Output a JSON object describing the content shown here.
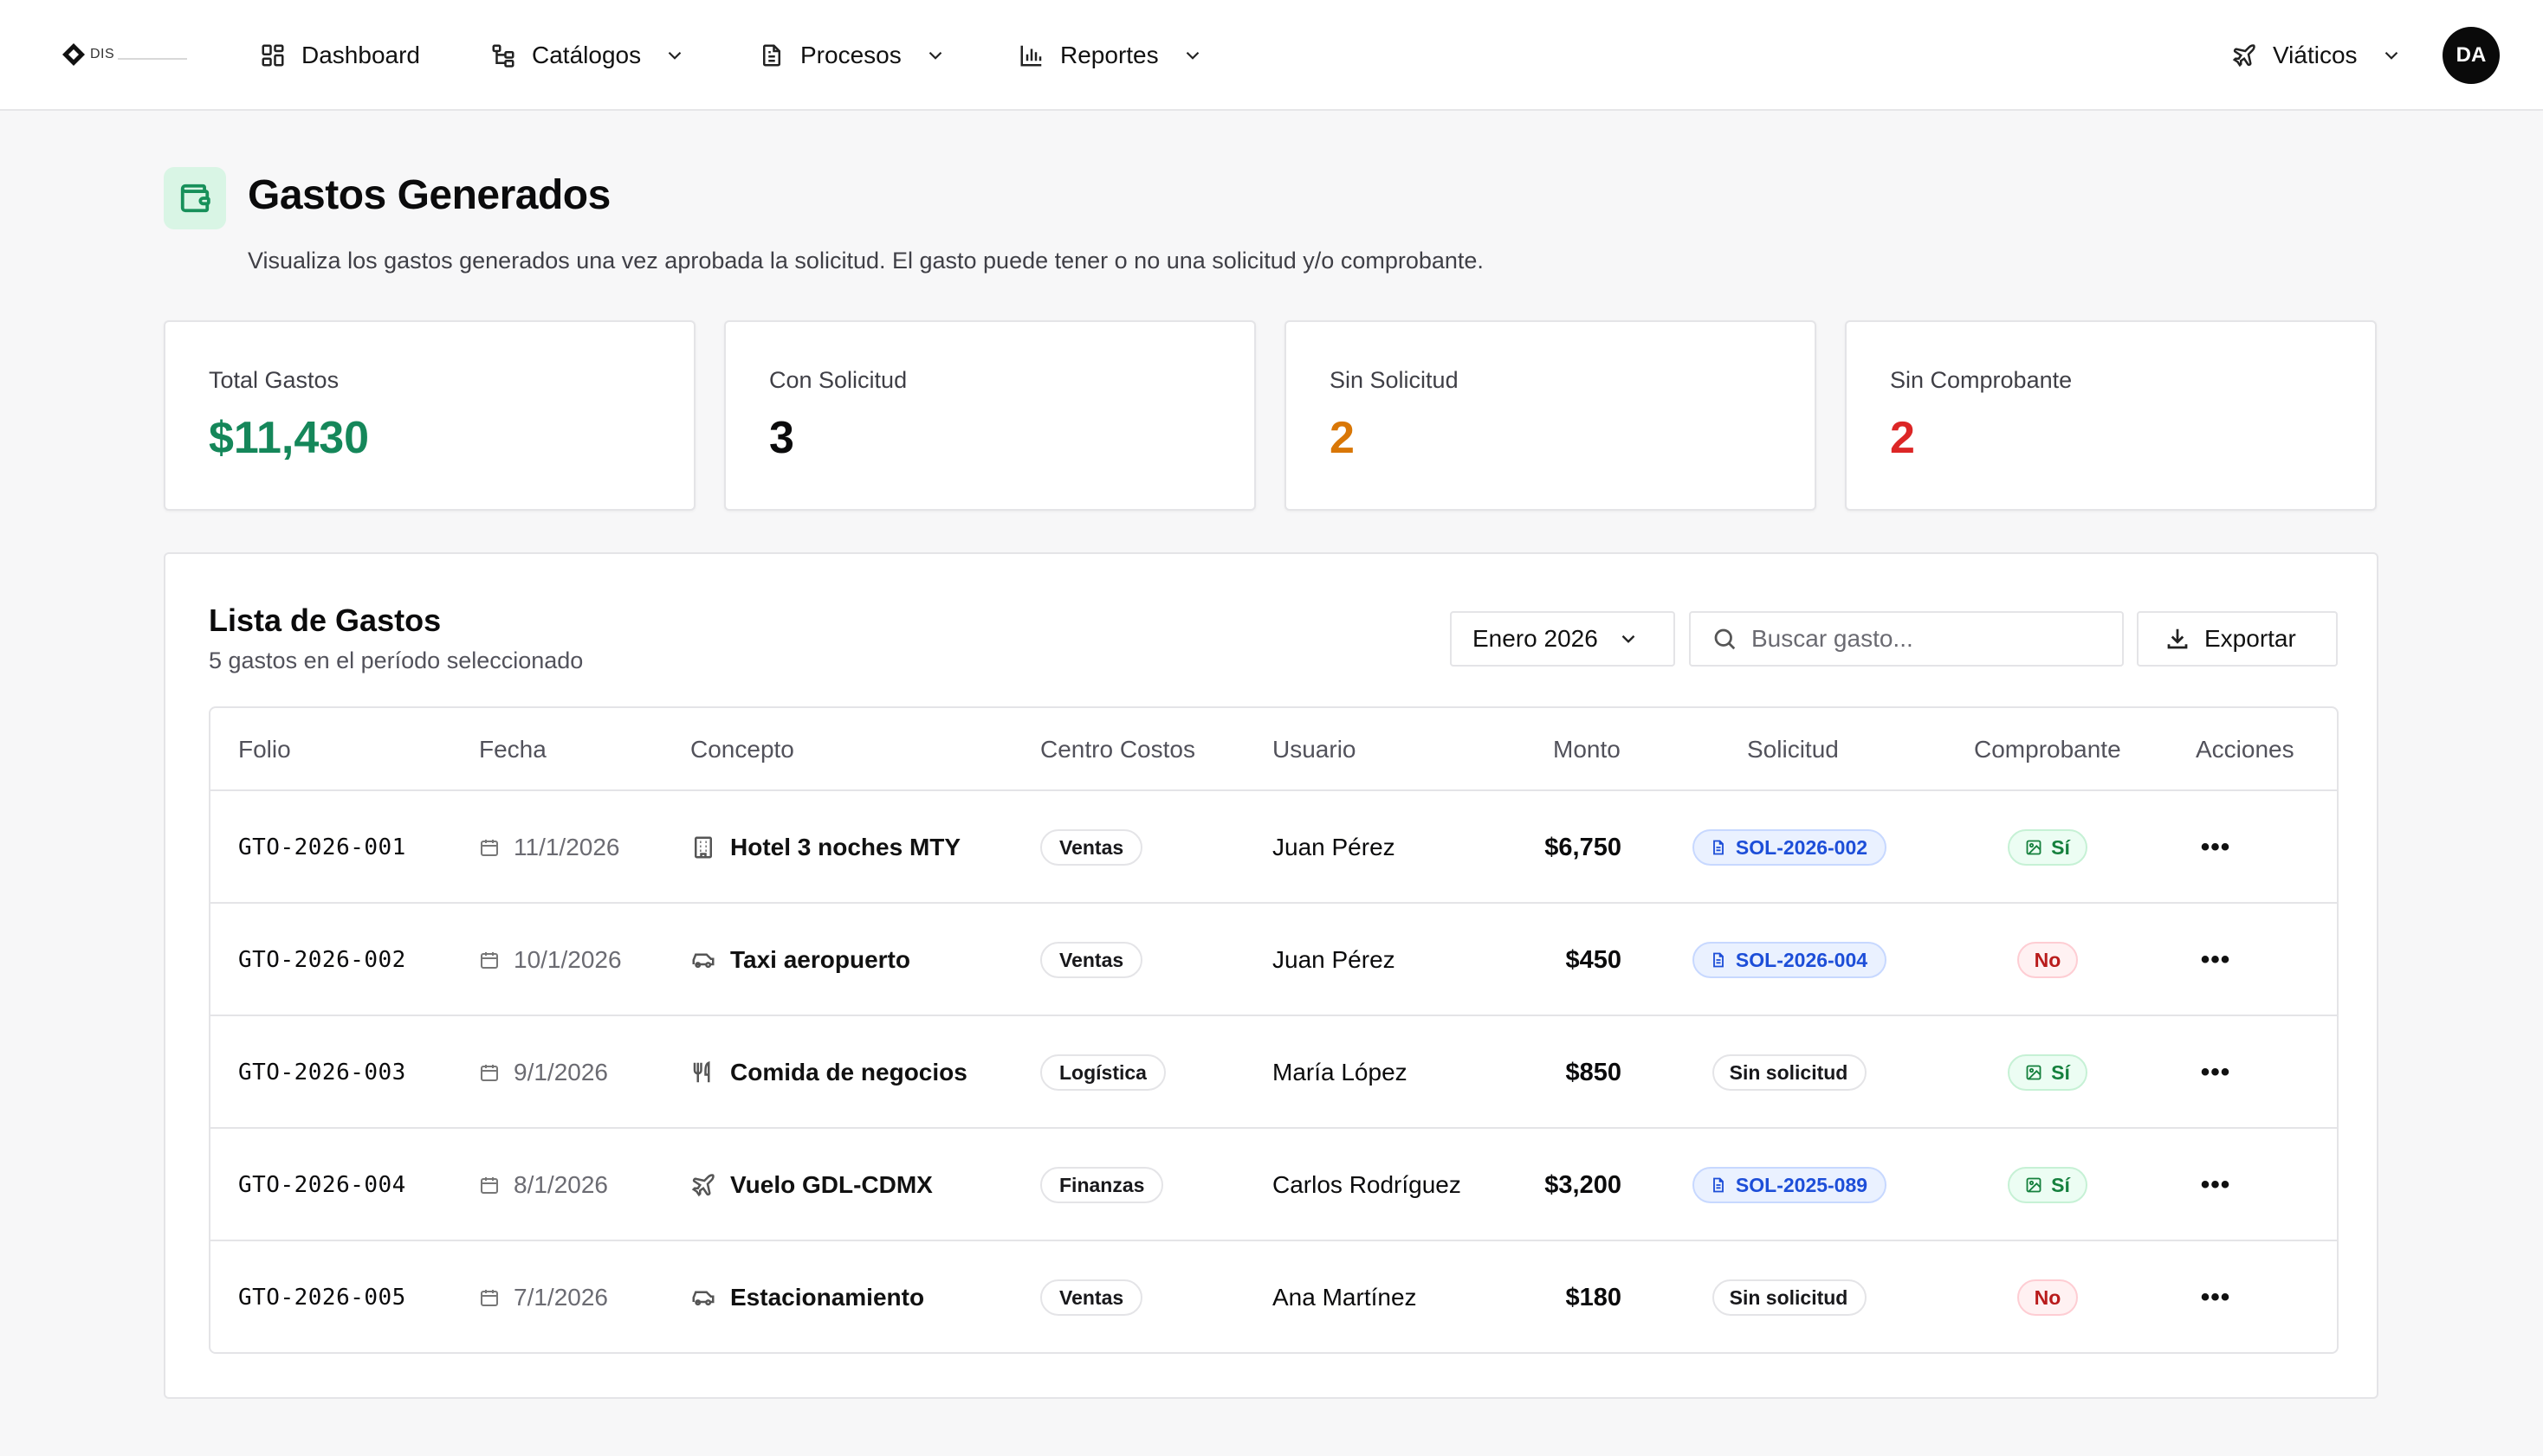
{
  "nav": {
    "logo_text": "DIS",
    "items": [
      {
        "label": "Dashboard",
        "icon": "dashboard-grid-icon"
      },
      {
        "label": "Catálogos",
        "icon": "catalog-tree-icon"
      },
      {
        "label": "Procesos",
        "icon": "document-icon"
      },
      {
        "label": "Reportes",
        "icon": "bar-chart-icon"
      }
    ],
    "module": {
      "label": "Viáticos",
      "icon": "plane-icon"
    },
    "avatar": "DA"
  },
  "header": {
    "title": "Gastos Generados",
    "subtitle": "Visualiza los gastos generados una vez aprobada la solicitud. El gasto puede tener o no una solicitud y/o comprobante.",
    "icon": "wallet-icon",
    "accent": "#17905a"
  },
  "stats": [
    {
      "label": "Total Gastos",
      "value": "$11,430",
      "color": "#15875a"
    },
    {
      "label": "Con Solicitud",
      "value": "3",
      "color": "#0b0b0c"
    },
    {
      "label": "Sin Solicitud",
      "value": "2",
      "color": "#d97706"
    },
    {
      "label": "Sin Comprobante",
      "value": "2",
      "color": "#dc2626"
    }
  ],
  "list": {
    "title": "Lista de Gastos",
    "subtitle": "5 gastos en el período seleccionado",
    "period": "Enero 2026",
    "search_placeholder": "Buscar gasto...",
    "export_label": "Exportar",
    "columns": [
      "Folio",
      "Fecha",
      "Concepto",
      "Centro Costos",
      "Usuario",
      "Monto",
      "Solicitud",
      "Comprobante",
      "Acciones"
    ],
    "rows": [
      {
        "folio": "GTO-2026-001",
        "fecha": "11/1/2026",
        "concepto": "Hotel 3 noches MTY",
        "concepto_icon": "building-icon",
        "centro": "Ventas",
        "usuario": "Juan Pérez",
        "monto": "$6,750",
        "solicitud": "SOL-2026-002",
        "solicitud_type": "linked",
        "comprobante": "Sí",
        "comprobante_type": "yes"
      },
      {
        "folio": "GTO-2026-002",
        "fecha": "10/1/2026",
        "concepto": "Taxi aeropuerto",
        "concepto_icon": "car-icon",
        "centro": "Ventas",
        "usuario": "Juan Pérez",
        "monto": "$450",
        "solicitud": "SOL-2026-004",
        "solicitud_type": "linked",
        "comprobante": "No",
        "comprobante_type": "no"
      },
      {
        "folio": "GTO-2026-003",
        "fecha": "9/1/2026",
        "concepto": "Comida de negocios",
        "concepto_icon": "utensils-icon",
        "centro": "Logística",
        "usuario": "María López",
        "monto": "$850",
        "solicitud": "Sin solicitud",
        "solicitud_type": "none",
        "comprobante": "Sí",
        "comprobante_type": "yes"
      },
      {
        "folio": "GTO-2026-004",
        "fecha": "8/1/2026",
        "concepto": "Vuelo GDL-CDMX",
        "concepto_icon": "plane-icon",
        "centro": "Finanzas",
        "usuario": "Carlos Rodríguez",
        "monto": "$3,200",
        "solicitud": "SOL-2025-089",
        "solicitud_type": "linked",
        "comprobante": "Sí",
        "comprobante_type": "yes"
      },
      {
        "folio": "GTO-2026-005",
        "fecha": "7/1/2026",
        "concepto": "Estacionamiento",
        "concepto_icon": "car-icon",
        "centro": "Ventas",
        "usuario": "Ana Martínez",
        "monto": "$180",
        "solicitud": "Sin solicitud",
        "solicitud_type": "none",
        "comprobante": "No",
        "comprobante_type": "no"
      }
    ]
  }
}
